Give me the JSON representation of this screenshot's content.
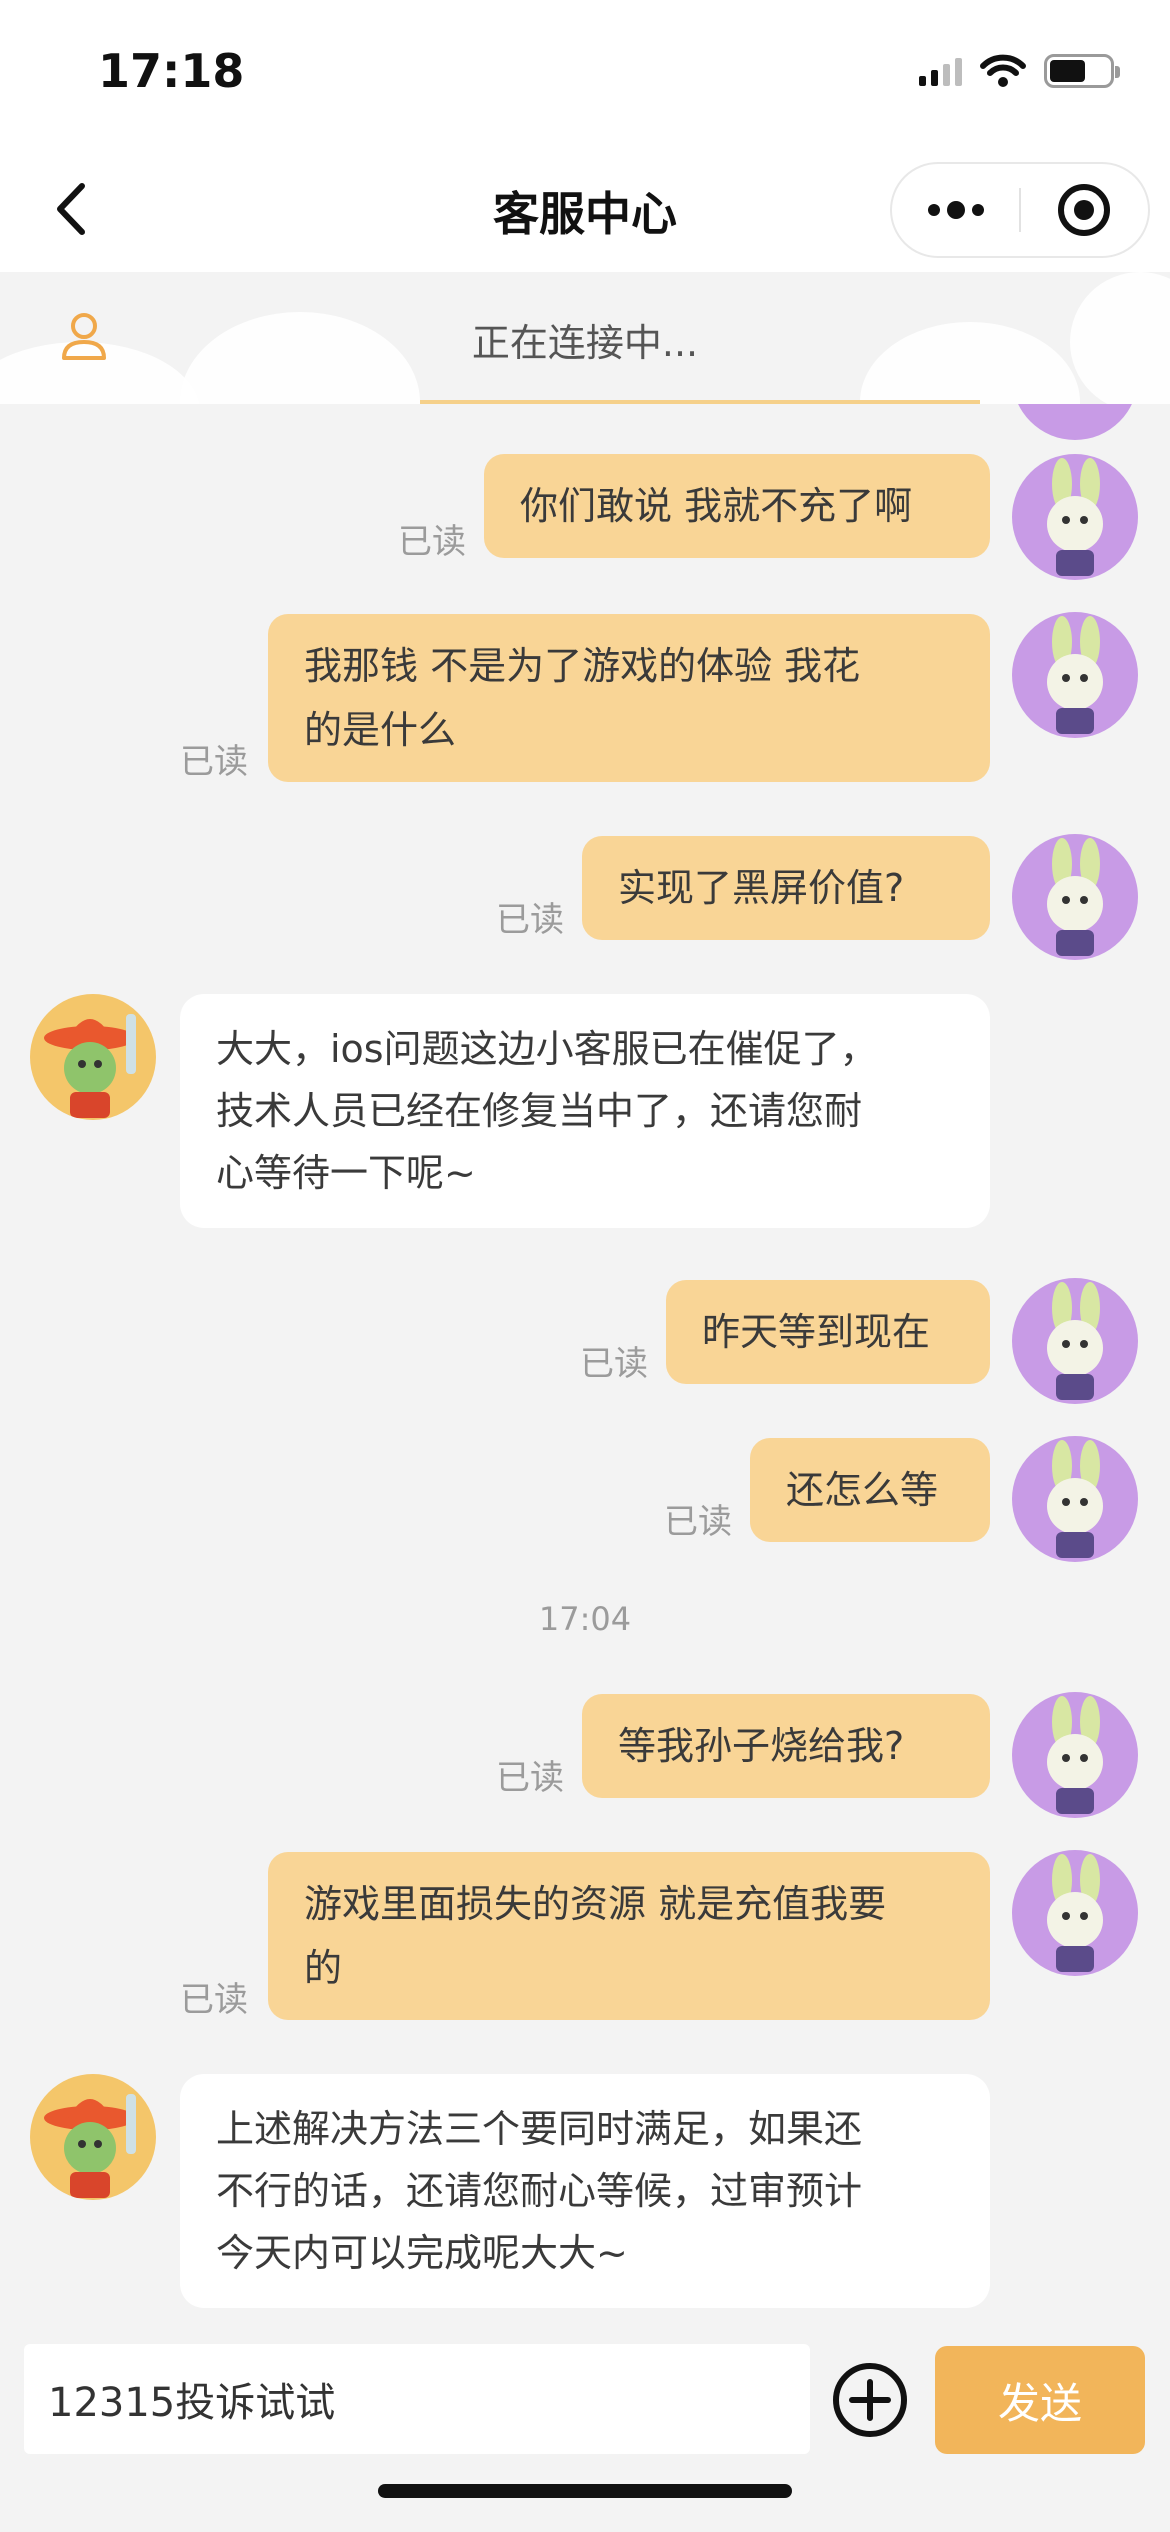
{
  "status_bar": {
    "time": "17:18",
    "icons": [
      "cellular-signal-icon",
      "wifi-icon",
      "battery-icon"
    ]
  },
  "nav": {
    "title": "客服中心",
    "back_icon": "chevron-left-icon",
    "more_icon": "more-dots-icon",
    "close_icon": "target-circle-icon"
  },
  "connection": {
    "status": "正在连接中...",
    "icon": "person-icon"
  },
  "messages": [
    {
      "side": "out",
      "text": "你们敢说 我就不充了啊",
      "read": "已读"
    },
    {
      "side": "out",
      "lines": [
        "我那钱 不是为了游戏的体验 我花",
        "的是什么"
      ],
      "read": "已读"
    },
    {
      "side": "out",
      "text": "实现了黑屏价值?",
      "read": "已读"
    },
    {
      "side": "in",
      "lines": [
        "大大，ios问题这边小客服已在催促了，",
        "技术人员已经在修复当中了，还请您耐",
        "心等待一下呢~"
      ]
    },
    {
      "side": "out",
      "text": "昨天等到现在",
      "read": "已读"
    },
    {
      "side": "out",
      "text": "还怎么等",
      "read": "已读"
    },
    {
      "side": "time",
      "text": "17:04"
    },
    {
      "side": "out",
      "text": "等我孙子烧给我?",
      "read": "已读"
    },
    {
      "side": "out",
      "lines": [
        "游戏里面损失的资源 就是充值我要",
        "的"
      ],
      "read": "已读"
    },
    {
      "side": "in",
      "lines": [
        "上述解决方法三个要同时满足，如果还",
        "不行的话，还请您耐心等候，过审预计",
        "今天内可以完成呢大大~"
      ]
    }
  ],
  "input": {
    "value": "12315投诉试试",
    "plus_icon": "plus-circle-icon",
    "send_label": "发送"
  },
  "colors": {
    "outgoing_bubble": "#f9d596",
    "incoming_bubble": "#ffffff",
    "send_button": "#f2b55a",
    "background": "#f3f3f3"
  }
}
